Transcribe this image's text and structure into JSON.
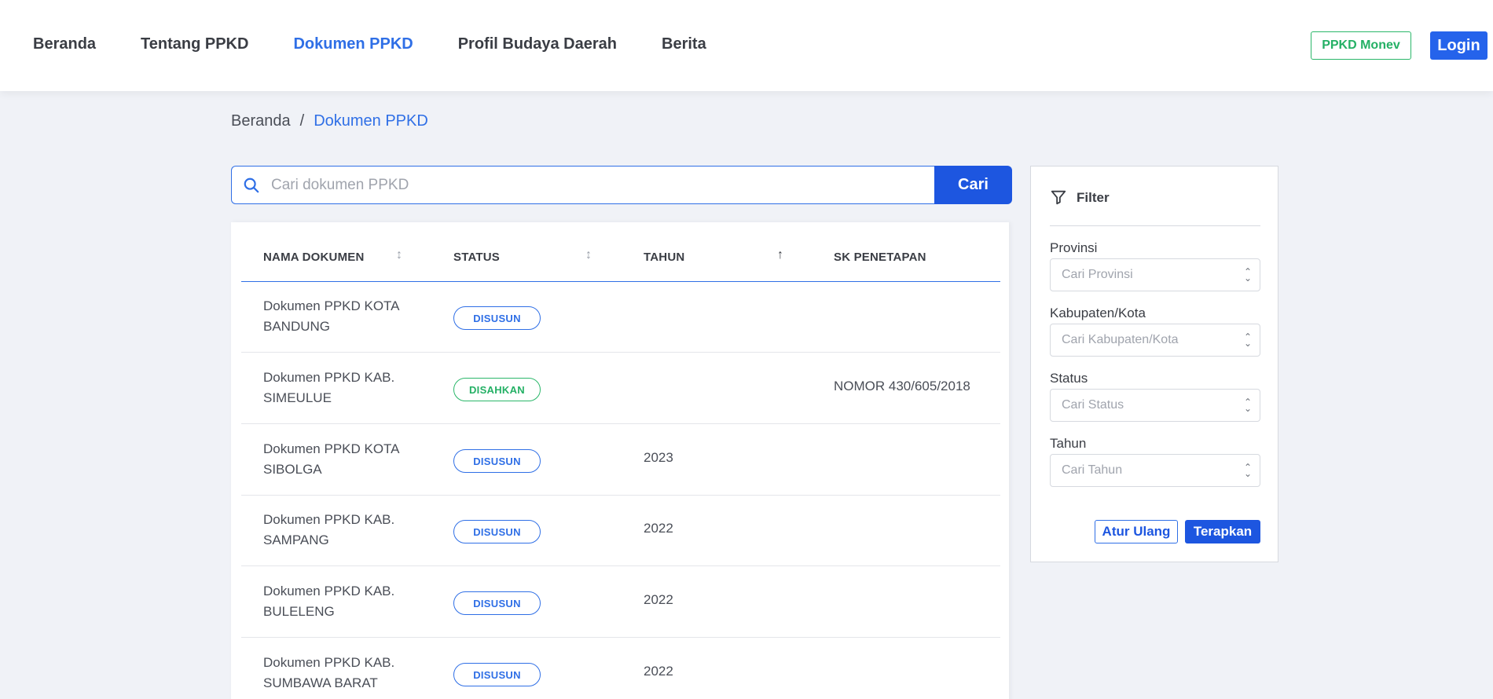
{
  "nav": {
    "items": [
      {
        "label": "Beranda"
      },
      {
        "label": "Tentang PPKD"
      },
      {
        "label": "Dokumen PPKD"
      },
      {
        "label": "Profil Budaya Daerah"
      },
      {
        "label": "Berita"
      }
    ],
    "active_index": 2,
    "monev_label": "PPKD Monev",
    "login_label": "Login"
  },
  "breadcrumb": {
    "home": "Beranda",
    "separator": "/",
    "current": "Dokumen PPKD"
  },
  "search": {
    "placeholder": "Cari dokumen PPKD",
    "value": "",
    "button_label": "Cari"
  },
  "table": {
    "columns": [
      "NAMA DOKUMEN",
      "STATUS",
      "TAHUN",
      "SK PENETAPAN"
    ],
    "rows": [
      {
        "name_line1": "Dokumen PPKD KOTA",
        "name_line2": "BANDUNG",
        "status": "DISUSUN",
        "year": "",
        "sk": ""
      },
      {
        "name_line1": "Dokumen PPKD KAB.",
        "name_line2": "SIMEULUE",
        "status": "DISAHKAN",
        "year": "",
        "sk": "NOMOR 430/605/2018"
      },
      {
        "name_line1": "Dokumen PPKD KOTA",
        "name_line2": "SIBOLGA",
        "status": "DISUSUN",
        "year": "2023",
        "sk": ""
      },
      {
        "name_line1": "Dokumen PPKD KAB.",
        "name_line2": "SAMPANG",
        "status": "DISUSUN",
        "year": "2022",
        "sk": ""
      },
      {
        "name_line1": "Dokumen PPKD KAB.",
        "name_line2": "BULELENG",
        "status": "DISUSUN",
        "year": "2022",
        "sk": ""
      },
      {
        "name_line1": "Dokumen PPKD KAB.",
        "name_line2": "SUMBAWA BARAT",
        "status": "DISUSUN",
        "year": "2022",
        "sk": ""
      }
    ]
  },
  "filter": {
    "title": "Filter",
    "fields": [
      {
        "label": "Provinsi",
        "placeholder": "Cari Provinsi"
      },
      {
        "label": "Kabupaten/Kota",
        "placeholder": "Cari Kabupaten/Kota"
      },
      {
        "label": "Status",
        "placeholder": "Cari Status"
      },
      {
        "label": "Tahun",
        "placeholder": "Cari Tahun"
      }
    ],
    "reset_label": "Atur Ulang",
    "apply_label": "Terapkan"
  },
  "colors": {
    "accent": "#2f6fe6",
    "primary_button": "#1d56e0",
    "success": "#24b065",
    "background": "#f0f2f7"
  },
  "icons": [
    "search-icon",
    "filter-icon",
    "sort-icon",
    "sort-ascending-icon",
    "chevron-updown-icon"
  ]
}
